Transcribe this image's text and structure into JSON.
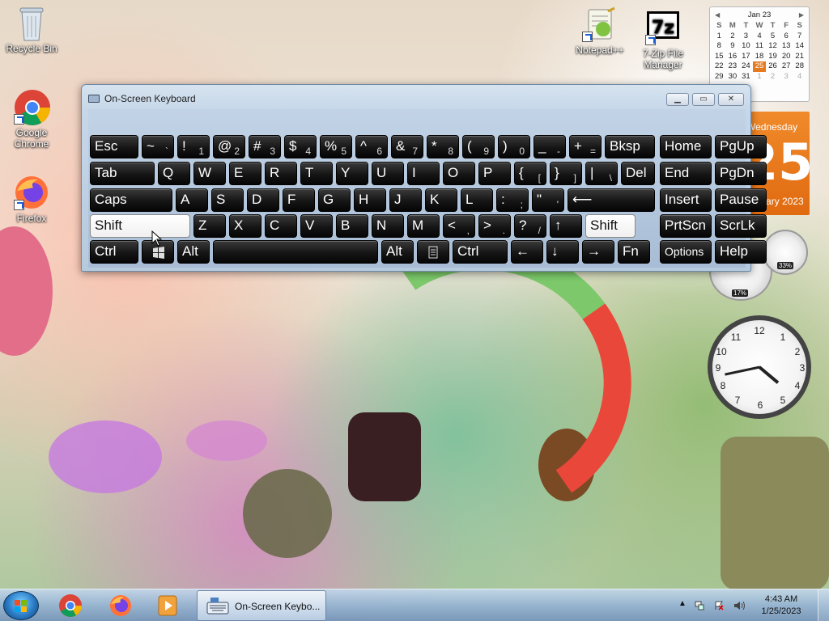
{
  "desktop": {
    "icons": [
      {
        "label": "Recycle Bin"
      },
      {
        "label": "Google Chrome"
      },
      {
        "label": "Firefox"
      },
      {
        "label": "Notepad++"
      },
      {
        "label": "7-Zip File Manager"
      }
    ]
  },
  "calendar_small": {
    "month": "Jan 23",
    "day_names": [
      "S",
      "M",
      "T",
      "W",
      "T",
      "F",
      "S"
    ],
    "weeks": [
      [
        "1",
        "2",
        "3",
        "4",
        "5",
        "6",
        "7"
      ],
      [
        "8",
        "9",
        "10",
        "11",
        "12",
        "13",
        "14"
      ],
      [
        "15",
        "16",
        "17",
        "18",
        "19",
        "20",
        "21"
      ],
      [
        "22",
        "23",
        "24",
        "25",
        "26",
        "27",
        "28"
      ],
      [
        "29",
        "30",
        "31",
        "1",
        "2",
        "3",
        "4"
      ]
    ],
    "today": "25",
    "today_color": "#e67a1f"
  },
  "calendar_big": {
    "weekday": "Wednesday",
    "day": "25",
    "month_year": "January 2023"
  },
  "meters": {
    "cpu": "17%",
    "memory": "33%"
  },
  "osk": {
    "title": "On-Screen Keyboard",
    "window_buttons": [
      "minimize",
      "maximize",
      "close"
    ],
    "rows": [
      [
        {
          "m": "Esc"
        },
        {
          "m": "~",
          "s": "`"
        },
        {
          "m": "!",
          "s": "1"
        },
        {
          "m": "@",
          "s": "2"
        },
        {
          "m": "#",
          "s": "3"
        },
        {
          "m": "$",
          "s": "4"
        },
        {
          "m": "%",
          "s": "5"
        },
        {
          "m": "^",
          "s": "6"
        },
        {
          "m": "&",
          "s": "7"
        },
        {
          "m": "*",
          "s": "8"
        },
        {
          "m": "(",
          "s": "9"
        },
        {
          "m": ")",
          "s": "0"
        },
        {
          "m": "_",
          "s": "-"
        },
        {
          "m": "+",
          "s": "="
        },
        {
          "m": "Bksp"
        },
        {
          "m": "Home"
        },
        {
          "m": "PgUp"
        }
      ],
      [
        {
          "m": "Tab"
        },
        {
          "m": "Q"
        },
        {
          "m": "W"
        },
        {
          "m": "E"
        },
        {
          "m": "R"
        },
        {
          "m": "T"
        },
        {
          "m": "Y"
        },
        {
          "m": "U"
        },
        {
          "m": "I"
        },
        {
          "m": "O"
        },
        {
          "m": "P"
        },
        {
          "m": "{",
          "s": "["
        },
        {
          "m": "}",
          "s": "]"
        },
        {
          "m": "|",
          "s": "\\"
        },
        {
          "m": "Del"
        },
        {
          "m": "End"
        },
        {
          "m": "PgDn"
        }
      ],
      [
        {
          "m": "Caps"
        },
        {
          "m": "A"
        },
        {
          "m": "S"
        },
        {
          "m": "D"
        },
        {
          "m": "F"
        },
        {
          "m": "G"
        },
        {
          "m": "H"
        },
        {
          "m": "J"
        },
        {
          "m": "K"
        },
        {
          "m": "L"
        },
        {
          "m": ":",
          "s": ";"
        },
        {
          "m": "\"",
          "s": "'"
        },
        {
          "m": "⟵"
        },
        {
          "m": "Insert"
        },
        {
          "m": "Pause"
        }
      ],
      [
        {
          "m": "Shift"
        },
        {
          "m": "Z"
        },
        {
          "m": "X"
        },
        {
          "m": "C"
        },
        {
          "m": "V"
        },
        {
          "m": "B"
        },
        {
          "m": "N"
        },
        {
          "m": "M"
        },
        {
          "m": "<",
          "s": ","
        },
        {
          "m": ">",
          "s": "."
        },
        {
          "m": "?",
          "s": "/"
        },
        {
          "m": "↑"
        },
        {
          "m": "Shift"
        },
        {
          "m": "PrtScn"
        },
        {
          "m": "ScrLk"
        }
      ],
      [
        {
          "m": "Ctrl"
        },
        {
          "m": "win-logo"
        },
        {
          "m": "Alt"
        },
        {
          "m": ""
        },
        {
          "m": "Alt"
        },
        {
          "m": "menu"
        },
        {
          "m": "Ctrl"
        },
        {
          "m": "←"
        },
        {
          "m": "↓"
        },
        {
          "m": "→"
        },
        {
          "m": "Fn"
        },
        {
          "m": "Options"
        },
        {
          "m": "Help"
        }
      ]
    ]
  },
  "taskbar": {
    "active_task": "On-Screen Keybo...",
    "clock_time": "4:43 AM",
    "clock_date": "1/25/2023"
  },
  "colors": {
    "accent": "#e67a1f",
    "key_bg": "#151515",
    "taskbar": "#96b4d2"
  }
}
